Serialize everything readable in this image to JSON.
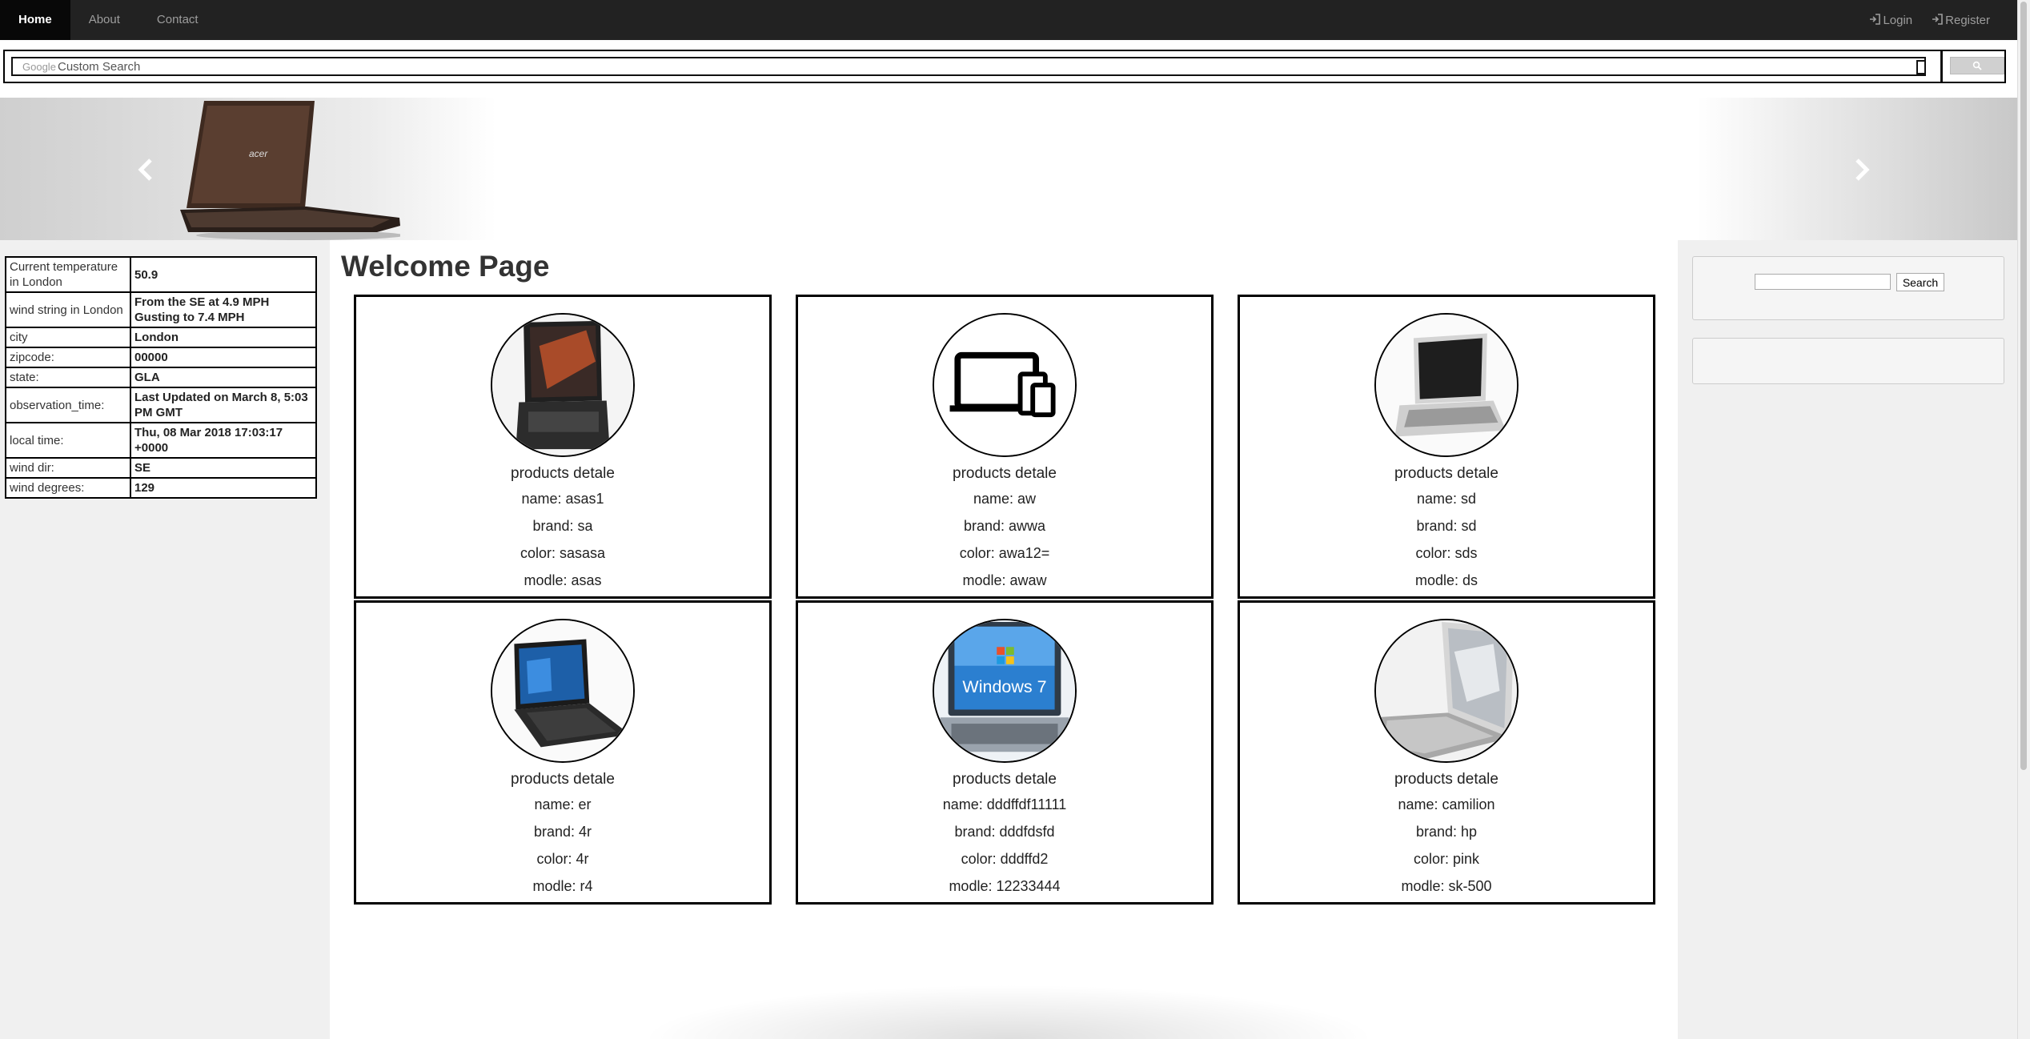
{
  "nav": {
    "items": [
      "Home",
      "About",
      "Contact"
    ],
    "login": "Login",
    "register": "Register"
  },
  "gsearch": {
    "brand": "Google",
    "placeholder": "Custom Search"
  },
  "weather": [
    {
      "label": "Current temperature in London",
      "value": "50.9"
    },
    {
      "label": "wind string in London",
      "value": "From the SE at 4.9 MPH Gusting to 7.4 MPH"
    },
    {
      "label": "city",
      "value": "London"
    },
    {
      "label": "zipcode:",
      "value": "00000"
    },
    {
      "label": "state:",
      "value": "GLA"
    },
    {
      "label": "observation_time:",
      "value": "Last Updated on March 8, 5:03 PM GMT"
    },
    {
      "label": "local time:",
      "value": "Thu, 08 Mar 2018 17:03:17 +0000"
    },
    {
      "label": "wind dir:",
      "value": "SE"
    },
    {
      "label": "wind degrees:",
      "value": "129"
    }
  ],
  "sidebar_search": {
    "button": "Search"
  },
  "page_title": "Welcome Page",
  "products": [
    {
      "title": "products detale",
      "name": "name: asas1",
      "brand": "brand: sa",
      "color": "color: sasasa",
      "model": "modle: asas"
    },
    {
      "title": "products detale",
      "name": "name: aw",
      "brand": "brand: awwa",
      "color": "color: awa12=",
      "model": "modle: awaw"
    },
    {
      "title": "products detale",
      "name": "name: sd",
      "brand": "brand: sd",
      "color": "color: sds",
      "model": "modle: ds"
    },
    {
      "title": "products detale",
      "name": "name: er",
      "brand": "brand: 4r",
      "color": "color: 4r",
      "model": "modle: r4"
    },
    {
      "title": "products detale",
      "name": "name: dddffdf11111",
      "brand": "brand: dddfdsfd",
      "color": "color: dddffd2",
      "model": "modle: 12233444"
    },
    {
      "title": "products detale",
      "name": "name: camilion",
      "brand": "brand: hp",
      "color": "color: pink",
      "model": "modle: sk-500"
    }
  ],
  "icons": {
    "login": "log-in-icon",
    "register": "log-in-icon",
    "search": "search-icon",
    "prev": "chevron-left-icon",
    "next": "chevron-right-icon"
  },
  "colors": {
    "navbar": "#222222",
    "nav_active": "#080808",
    "side_bg": "#f0f0f0"
  }
}
